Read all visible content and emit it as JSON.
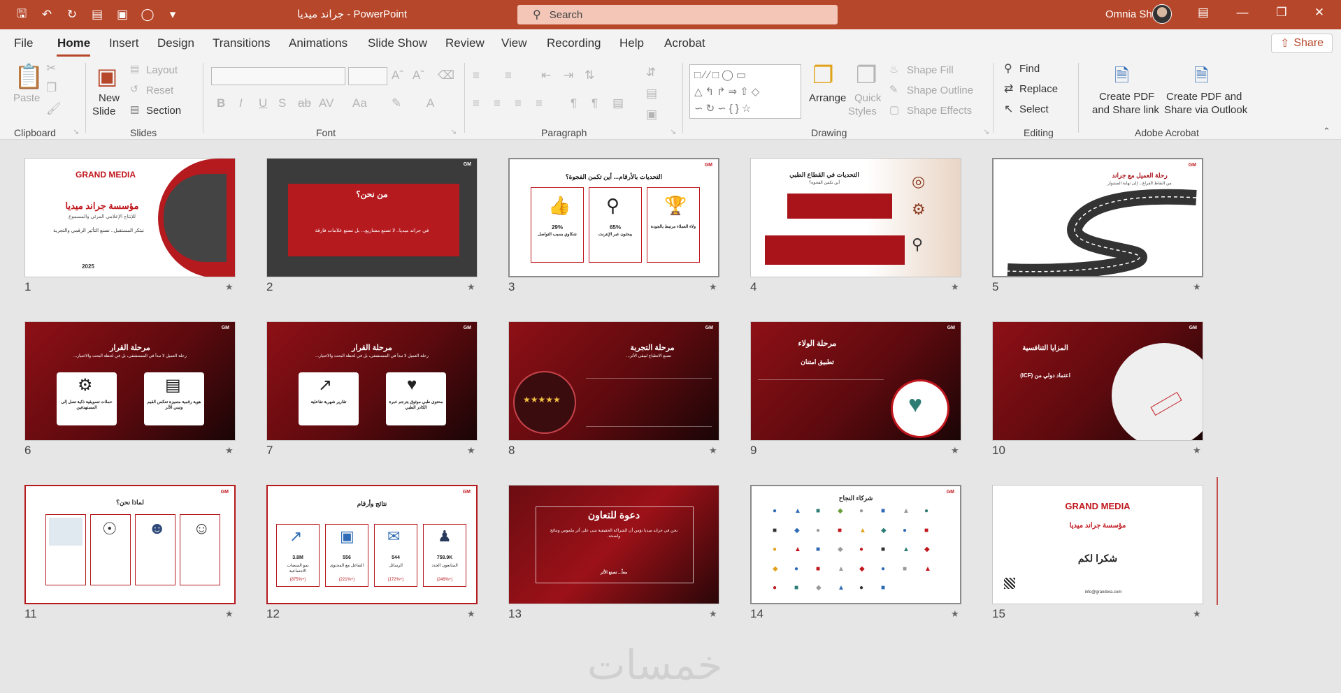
{
  "window": {
    "doc_title": "جراند ميديا",
    "app_name": "PowerPoint",
    "title_separator": "-",
    "search_placeholder": "Search",
    "user_name": "Omnia Sherif",
    "accent_color": "#b7472a"
  },
  "menu": {
    "tabs": [
      "File",
      "Home",
      "Insert",
      "Design",
      "Transitions",
      "Animations",
      "Slide Show",
      "Review",
      "View",
      "Recording",
      "Help",
      "Acrobat"
    ],
    "active": "Home",
    "share_label": "Share"
  },
  "ribbon": {
    "clipboard": {
      "label": "Clipboard",
      "paste": "Paste"
    },
    "slides": {
      "label": "Slides",
      "new_slide_1": "New",
      "new_slide_2": "Slide",
      "layout": "Layout",
      "reset": "Reset",
      "section": "Section"
    },
    "font": {
      "label": "Font"
    },
    "paragraph": {
      "label": "Paragraph"
    },
    "drawing": {
      "label": "Drawing",
      "arrange": "Arrange",
      "quick_styles_1": "Quick",
      "quick_styles_2": "Styles",
      "shape_fill": "Shape Fill",
      "shape_outline": "Shape Outline",
      "shape_effects": "Shape Effects"
    },
    "editing": {
      "label": "Editing",
      "find": "Find",
      "replace": "Replace",
      "select": "Select"
    },
    "acrobat": {
      "label": "Adobe Acrobat",
      "create_pdf_link_1": "Create PDF",
      "create_pdf_link_2": "and Share link",
      "create_pdf_outlook_1": "Create PDF and",
      "create_pdf_outlook_2": "Share via Outlook"
    }
  },
  "slides": [
    {
      "num": "1",
      "title": "مؤسسة جراند ميديا",
      "logo": "GRAND MEDIA",
      "subtitle": "للإنتاج الإعلامي المرئي والمسموع",
      "body": "نبتكر المستقبل.. نصنع التأثير الرقمي والتجربة",
      "year": "2025"
    },
    {
      "num": "2",
      "title": "من نحن؟",
      "body": "في جراند ميديا.. لا نصنع مشاريع... بل نصنع علامات فارقة"
    },
    {
      "num": "3",
      "title": "التحديات بالأرقام... أين تكمن الفجوة؟",
      "stats": [
        "29%",
        "65%",
        "ولاء العملاء مرتبط بالجودة"
      ],
      "captions": [
        "شكاوي بسبب التواصل",
        "يبحثون عبر الإنترنت",
        ""
      ]
    },
    {
      "num": "4",
      "title": "التحديات في القطاع الطبي",
      "subtitle": "أين تكمن الفجوة؟"
    },
    {
      "num": "5",
      "title": "رحلة العميل مع جراند",
      "subtitle": "من النقاط الفراغ... إلى نهاية المشوار"
    },
    {
      "num": "6",
      "title": "مرحلة القرار",
      "subtitle": "رحلة العميل لا تبدأ في المستشفى، بل في لحظة البحث والاختيار...",
      "cards": [
        "حملات تسويقية ذكية تصل إلى المستهدفين",
        "هوية رقمية متميزة تعكس القيم وتبني الأثر"
      ]
    },
    {
      "num": "7",
      "title": "مرحلة القرار",
      "subtitle": "رحلة العميل لا تبدأ في المستشفى، بل في لحظة البحث والاختيار...",
      "cards": [
        "تقارير شهرية تفاعلية",
        "محتوى طبي موثوق يترجم خبرة الكادر الطبي"
      ]
    },
    {
      "num": "8",
      "title": "مرحلة التجربة",
      "subtitle": "تصنع الانطباع ليبقى الأثر..."
    },
    {
      "num": "9",
      "title": "مرحلة الولاء",
      "subtitle": "تطبيق امتنان"
    },
    {
      "num": "10",
      "title": "المزايا التنافسية",
      "subtitle": "اعتماد دولي من (ICF)"
    },
    {
      "num": "11",
      "title": "لماذا نحن؟"
    },
    {
      "num": "12",
      "title": "نتائج وأرقام",
      "stats": [
        "3.8M",
        "556",
        "544",
        "758.9K"
      ],
      "captions": [
        "نمو المنصات الاجتماعية",
        "التفاعل مع المحتوى",
        "الرسائل",
        "المتابعون الجدد"
      ],
      "changes": [
        "(+875%)",
        "(+221%)",
        "(+172%)",
        "(+248%)"
      ]
    },
    {
      "num": "13",
      "title": "دعوة للتعاون",
      "body": "نحن في جراند ميديا نؤمن أن الشراكة الحقيقية تبنى على أثر ملموس ونتائج واضحة.",
      "closing": "معاً... نصنع الأثر"
    },
    {
      "num": "14",
      "title": "شركاء النجاح"
    },
    {
      "num": "15",
      "title": "شكرا لكم",
      "logo": "GRAND MEDIA",
      "subtitle": "مؤسسة جراند ميديا",
      "email": "info@grandera.com"
    }
  ],
  "watermark": "خمسات"
}
